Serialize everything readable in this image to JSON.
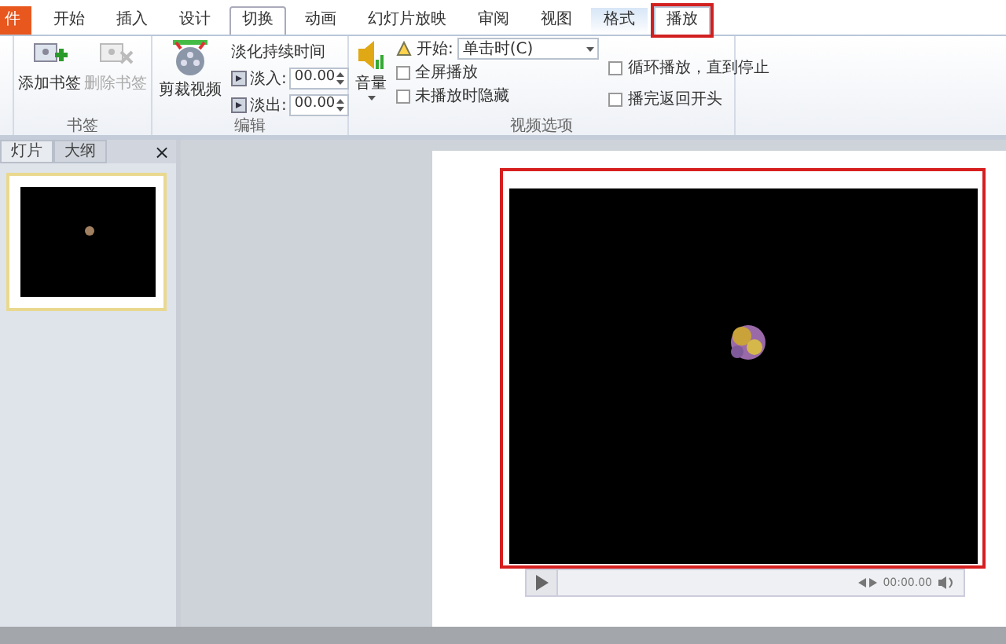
{
  "ribbon_tabs": [
    {
      "label": "件",
      "kind": "file",
      "selected": false,
      "hovered": false,
      "annotated": false
    },
    {
      "label": "开始",
      "kind": "normal",
      "selected": false,
      "hovered": false,
      "annotated": false
    },
    {
      "label": "插入",
      "kind": "normal",
      "selected": false,
      "hovered": false,
      "annotated": false
    },
    {
      "label": "设计",
      "kind": "normal",
      "selected": false,
      "hovered": false,
      "annotated": false
    },
    {
      "label": "切换",
      "kind": "normal",
      "selected": false,
      "hovered": true,
      "annotated": false
    },
    {
      "label": "动画",
      "kind": "normal",
      "selected": false,
      "hovered": false,
      "annotated": false
    },
    {
      "label": "幻灯片放映",
      "kind": "normal",
      "selected": false,
      "hovered": false,
      "annotated": false
    },
    {
      "label": "审阅",
      "kind": "normal",
      "selected": false,
      "hovered": false,
      "annotated": false
    },
    {
      "label": "视图",
      "kind": "normal",
      "selected": false,
      "hovered": false,
      "annotated": false
    },
    {
      "label": "格式",
      "kind": "context",
      "selected": false,
      "hovered": false,
      "annotated": false
    },
    {
      "label": "播放",
      "kind": "context",
      "selected": true,
      "hovered": false,
      "annotated": true
    }
  ],
  "bookmarks_group": {
    "buttons": [
      {
        "label": "添加书签",
        "disabled": false
      },
      {
        "label": "删除书签",
        "disabled": true
      }
    ],
    "label": "书签"
  },
  "editing_group": {
    "trim_button": "剪裁视频",
    "fade_title": "淡化持续时间",
    "fade_in": {
      "label": "淡入:",
      "value": "00.00"
    },
    "fade_out": {
      "label": "淡出:",
      "value": "00.00"
    },
    "label": "编辑"
  },
  "video_options_group": {
    "volume_button": "音量",
    "start": {
      "label": "开始:",
      "value": "单击时(C)"
    },
    "checkboxes": [
      {
        "label": "全屏播放",
        "checked": false
      },
      {
        "label": "未播放时隐藏",
        "checked": false
      },
      {
        "label": "循环播放，直到停止",
        "checked": false
      },
      {
        "label": "播完返回开头",
        "checked": false
      }
    ],
    "label": "视频选项"
  },
  "left_pane": {
    "tabs": [
      {
        "label": "灯片",
        "selected": true
      },
      {
        "label": "大纲",
        "selected": false
      }
    ],
    "close": "×"
  },
  "video": {
    "annotated": true,
    "time": "00:00.00"
  }
}
